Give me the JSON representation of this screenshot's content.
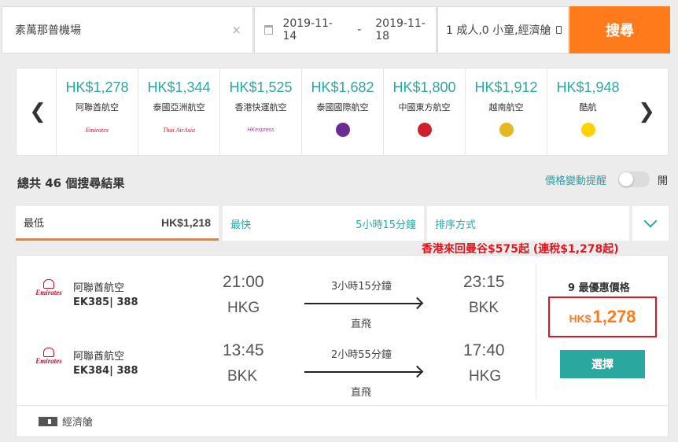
{
  "search": {
    "airport": "素萬那普機場",
    "clear_icon": "×",
    "date_from": "2019-11-14",
    "date_sep": "-",
    "date_to": "2019-11-18",
    "passengers": "1 成人,0 小童,經濟艙",
    "search_label": "搜尋"
  },
  "carousel": {
    "items": [
      {
        "price": "HK$1,278",
        "name": "阿聯酋航空",
        "logo": "Emirates",
        "logo_style": "emirates"
      },
      {
        "price": "HK$1,344",
        "name": "泰國亞洲航空",
        "logo": "Thai AirAsia",
        "logo_style": "thaiasia"
      },
      {
        "price": "HK$1,525",
        "name": "香港快運航空",
        "logo": "HKexpress",
        "logo_style": "hkx"
      },
      {
        "price": "HK$1,682",
        "name": "泰國國際航空",
        "logo": "",
        "logo_style": "dot",
        "logo_color": "#6b2c91"
      },
      {
        "price": "HK$1,800",
        "name": "中國東方航空",
        "logo": "",
        "logo_style": "dot",
        "logo_color": "#d0202e"
      },
      {
        "price": "HK$1,912",
        "name": "越南航空",
        "logo": "",
        "logo_style": "dot",
        "logo_color": "#e5b81f"
      },
      {
        "price": "HK$1,948",
        "name": "酷航",
        "logo": "scoot",
        "logo_style": "dot",
        "logo_color": "#ffd200"
      }
    ]
  },
  "results": {
    "count_text": "總共 46 個搜尋結果",
    "price_alert_label": "價格變動提醒",
    "toggle_label": "開"
  },
  "tabs": {
    "lowest_label": "最低",
    "lowest_value": "HK$1,218",
    "fastest_label": "最快",
    "fastest_value": "5小時15分鐘",
    "sort_label": "排序方式"
  },
  "promo": "香港來回曼谷$575起 (連稅$1,278起)",
  "result": {
    "legs": [
      {
        "airline": "阿聯酋航空",
        "flight": "EK385| 388",
        "logo_text": "Emirates",
        "dep_time": "21:00",
        "dep_code": "HKG",
        "duration": "3小時15分鐘",
        "stops": "直飛",
        "arr_time": "23:15",
        "arr_code": "BKK"
      },
      {
        "airline": "阿聯酋航空",
        "flight": "EK384| 388",
        "logo_text": "Emirates",
        "dep_time": "13:45",
        "dep_code": "BKK",
        "duration": "2小時55分鐘",
        "stops": "直飛",
        "arr_time": "17:40",
        "arr_code": "HKG"
      }
    ],
    "deal_label": "9 最優惠價格",
    "currency": "HK$",
    "price": "1,278",
    "select_label": "選擇",
    "cabin": "經濟艙"
  }
}
